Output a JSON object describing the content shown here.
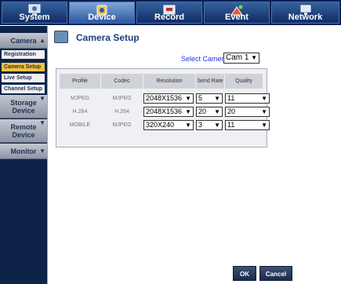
{
  "topnav": {
    "tabs": [
      {
        "label": "System",
        "icon": "system-icon"
      },
      {
        "label": "Device",
        "icon": "device-icon"
      },
      {
        "label": "Record",
        "icon": "record-icon"
      },
      {
        "label": "Event",
        "icon": "event-icon"
      },
      {
        "label": "Network",
        "icon": "network-icon"
      }
    ],
    "active": "Device"
  },
  "sidebar": {
    "camera_header": "Camera",
    "items": [
      "Registration",
      "Camera Setup",
      "Live Setup",
      "Channel Setup"
    ],
    "active_item": "Camera Setup",
    "storage_header": "Storage Device",
    "remote_header": "Remote Device",
    "monitor_header": "Monitor"
  },
  "page": {
    "title": "Camera Setup",
    "select_camera_label": "Select Camera",
    "select_camera_value": "Cam 1"
  },
  "table": {
    "columns": [
      "Profile",
      "Codec",
      "Resolution",
      "Send Rate",
      "Quality"
    ],
    "rows": [
      {
        "profile": "MJPEG",
        "codec": "MJPEG",
        "resolution": "2048X1536",
        "send_rate": "5",
        "quality": "11"
      },
      {
        "profile": "H.264",
        "codec": "H.264",
        "resolution": "2048X1536",
        "send_rate": "20",
        "quality": "20"
      },
      {
        "profile": "MOBILE",
        "codec": "MJPEG",
        "resolution": "320X240",
        "send_rate": "3",
        "quality": "11"
      }
    ]
  },
  "buttons": {
    "ok": "OK",
    "cancel": "Cancel"
  },
  "colors": {
    "nav_bg": "#0b1f52",
    "active_item": "#f1c23f",
    "select_camera_label": "#1e36e0"
  }
}
